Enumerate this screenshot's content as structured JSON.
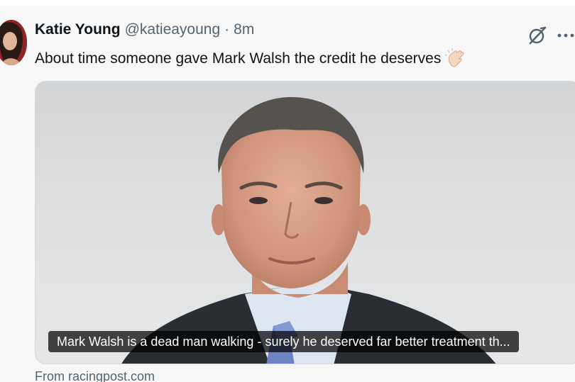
{
  "tweet": {
    "author_name": "Katie Young",
    "author_handle": "@katieayoung",
    "separator": "·",
    "timestamp": "8m",
    "text": "About time someone gave Mark Walsh the credit he deserves",
    "emoji_icon": "clapping-hands-icon"
  },
  "card": {
    "headline": "Mark Walsh is a dead man walking - surely he deserved far better treatment th...",
    "source_label": "From racingpost.com"
  },
  "icons": {
    "grok": "grok-icon",
    "more": "more-options-icon"
  },
  "colors": {
    "text_primary": "#0f1419",
    "text_secondary": "#536471",
    "tweet_bg": "#f7f7f7",
    "caption_bg": "#000000b8"
  }
}
